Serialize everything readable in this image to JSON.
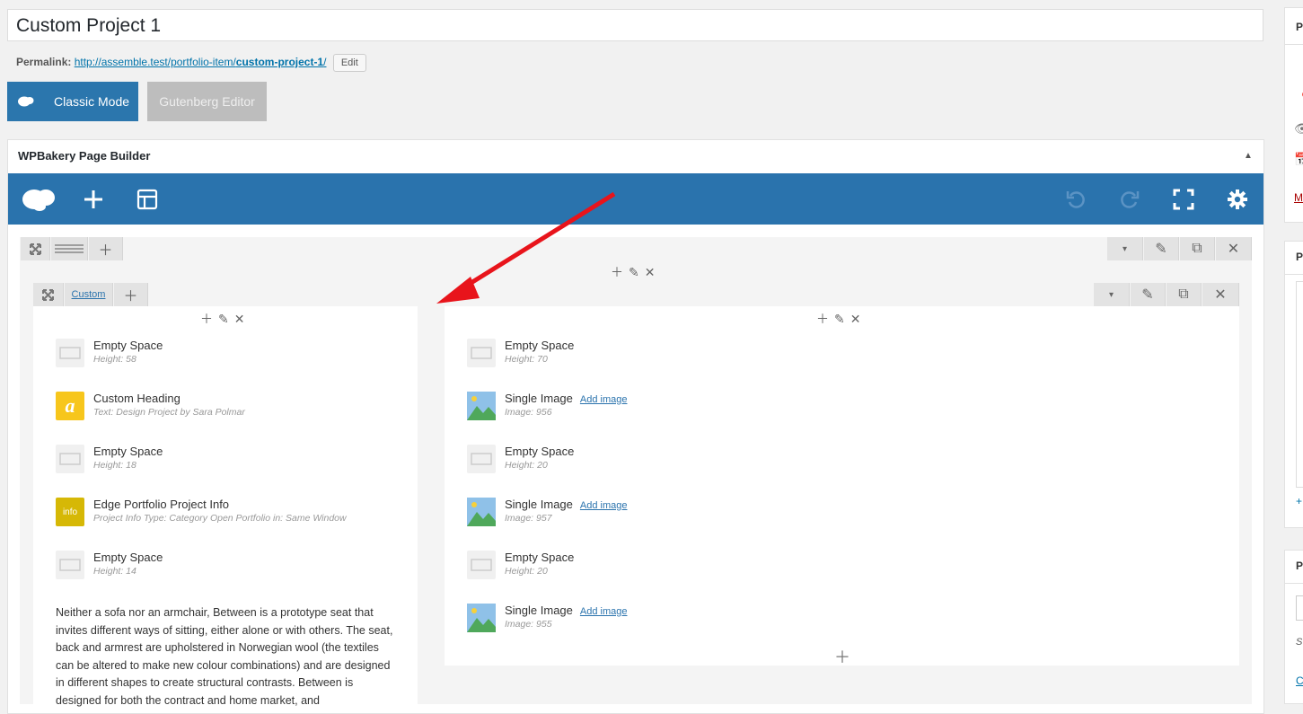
{
  "post_title": "Custom Project 1",
  "permalink": {
    "label": "Permalink:",
    "url_base": "http://assemble.test/portfolio-item/",
    "slug": "custom-project-1",
    "url_end": "/",
    "edit_label": "Edit"
  },
  "modes": {
    "classic": "Classic Mode",
    "gutenberg": "Gutenberg Editor"
  },
  "builder": {
    "title": "WPBakery Page Builder",
    "column_tag": "Custom"
  },
  "left_column": [
    {
      "name": "Empty Space",
      "sub": "Height: 58",
      "icon": "empty-space"
    },
    {
      "name": "Custom Heading",
      "sub": "Text: Design Project by Sara Polmar",
      "icon": "custom-heading",
      "color": "#f7c61c"
    },
    {
      "name": "Empty Space",
      "sub": "Height: 18",
      "icon": "empty-space"
    },
    {
      "name": "Edge Portfolio Project Info",
      "sub": "Project Info Type: Category  Open Portfolio in: Same Window",
      "icon": "info",
      "color": "#d6b806",
      "icon_text": "info"
    },
    {
      "name": "Empty Space",
      "sub": "Height: 14",
      "icon": "empty-space"
    }
  ],
  "heading_glyph": "a",
  "paragraph": "Neither a sofa nor an armchair, Between is a prototype seat that invites different ways of sitting, either alone or with others. The seat, back and armrest are upholstered in Norwegian wool (the textiles can be altered to make new colour combinations) and are designed in different shapes to create structural contrasts. Between is designed for both the contract and home market, and",
  "right_column": [
    {
      "name": "Empty Space",
      "sub": "Height: 70",
      "icon": "empty-space"
    },
    {
      "name": "Single Image",
      "sub": "Image: 956",
      "icon": "image",
      "link": "Add image"
    },
    {
      "name": "Empty Space",
      "sub": "Height: 20",
      "icon": "empty-space"
    },
    {
      "name": "Single Image",
      "sub": "Image: 957",
      "icon": "image",
      "link": "Add image"
    },
    {
      "name": "Empty Space",
      "sub": "Height: 20",
      "icon": "empty-space"
    },
    {
      "name": "Single Image",
      "sub": "Image: 955",
      "icon": "image",
      "link": "Add image"
    }
  ],
  "colors": {
    "brand": "#2a73ad",
    "arrow": "#e8141b"
  }
}
